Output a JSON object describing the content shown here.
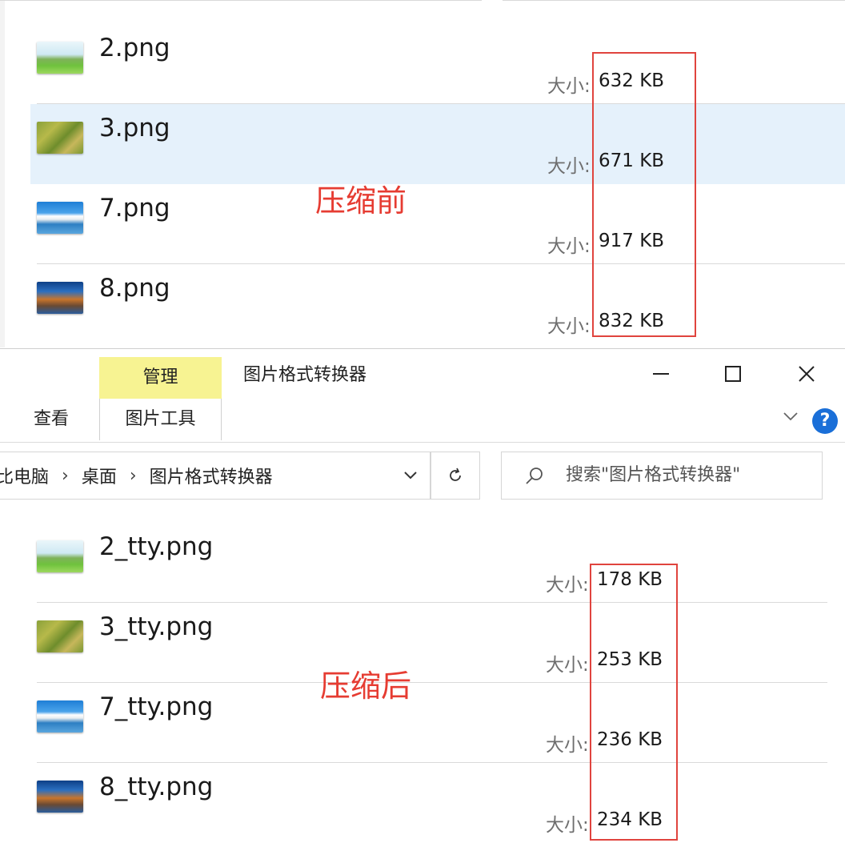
{
  "before": {
    "annotation": "压缩前",
    "files": [
      {
        "name": "2.png",
        "size_label": "大小:",
        "size": "632 KB",
        "thumb": "meadow-thumbnail"
      },
      {
        "name": "3.png",
        "size_label": "大小:",
        "size": "671 KB",
        "thumb": "forest-thumbnail",
        "selected": true
      },
      {
        "name": "7.png",
        "size_label": "大小:",
        "size": "917 KB",
        "thumb": "lake-thumbnail"
      },
      {
        "name": "8.png",
        "size_label": "大小:",
        "size": "832 KB",
        "thumb": "city-thumbnail"
      }
    ]
  },
  "window": {
    "title": "图片格式转换器",
    "tabs": {
      "manage": "管理",
      "picture_tools": "图片工具",
      "view": "查看"
    },
    "breadcrumbs": [
      "比电脑",
      "桌面",
      "图片格式转换器"
    ],
    "search_placeholder": "搜索\"图片格式转换器\"",
    "controls": [
      "minimize-icon",
      "maximize-icon",
      "close-icon"
    ]
  },
  "after": {
    "annotation": "压缩后",
    "files": [
      {
        "name": "2_tty.png",
        "size_label": "大小:",
        "size": "178 KB",
        "thumb": "meadow-thumbnail"
      },
      {
        "name": "3_tty.png",
        "size_label": "大小:",
        "size": "253 KB",
        "thumb": "forest-thumbnail"
      },
      {
        "name": "7_tty.png",
        "size_label": "大小:",
        "size": "236 KB",
        "thumb": "lake-thumbnail"
      },
      {
        "name": "8_tty.png",
        "size_label": "大小:",
        "size": "234 KB",
        "thumb": "city-thumbnail"
      }
    ]
  },
  "colors": {
    "selection": "#e5f1fb",
    "annotation_red": "#e63c32",
    "manage_tab": "#f7f392",
    "help_blue": "#1a6fd8"
  }
}
